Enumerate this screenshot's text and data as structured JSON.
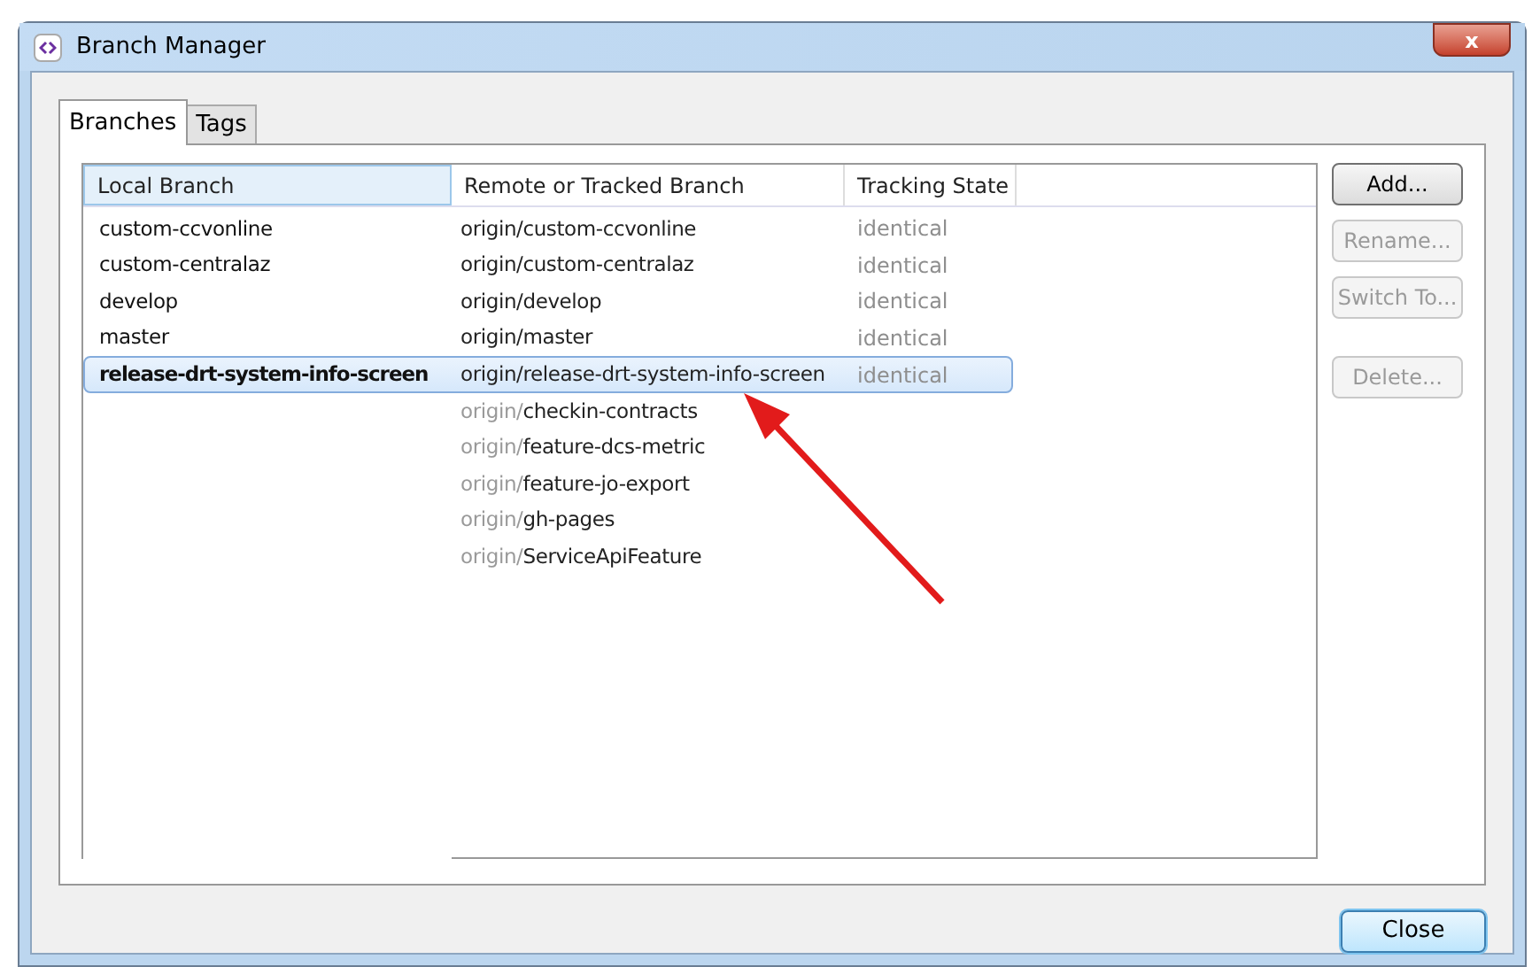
{
  "window": {
    "title": "Branch Manager",
    "close_label": "x"
  },
  "tabs": [
    {
      "label": "Branches",
      "selected": true
    },
    {
      "label": "Tags",
      "selected": false
    }
  ],
  "table": {
    "columns": [
      "Local Branch",
      "Remote or Tracked Branch",
      "Tracking State"
    ],
    "rows": [
      {
        "kind": "tracked",
        "local": "custom-ccvonline",
        "remote_prefix": "origin/",
        "remote_name": "custom-ccvonline",
        "state": "identical",
        "selected": false
      },
      {
        "kind": "tracked",
        "local": "custom-centralaz",
        "remote_prefix": "origin/",
        "remote_name": "custom-centralaz",
        "state": "identical",
        "selected": false
      },
      {
        "kind": "tracked",
        "local": "develop",
        "remote_prefix": "origin/",
        "remote_name": "develop",
        "state": "identical",
        "selected": false
      },
      {
        "kind": "tracked",
        "local": "master",
        "remote_prefix": "origin/",
        "remote_name": "master",
        "state": "identical",
        "selected": false
      },
      {
        "kind": "tracked",
        "local": "release-drt-system-info-screen",
        "remote_prefix": "origin/",
        "remote_name": "release-drt-system-info-screen",
        "state": "identical",
        "selected": true
      },
      {
        "kind": "remote",
        "remote_prefix": "origin/",
        "remote_name": "checkin-contracts",
        "selected": false
      },
      {
        "kind": "remote",
        "remote_prefix": "origin/",
        "remote_name": "feature-dcs-metric",
        "selected": false
      },
      {
        "kind": "remote",
        "remote_prefix": "origin/",
        "remote_name": "feature-jo-export",
        "selected": false
      },
      {
        "kind": "remote",
        "remote_prefix": "origin/",
        "remote_name": "gh-pages",
        "selected": false
      },
      {
        "kind": "remote",
        "remote_prefix": "origin/",
        "remote_name": "ServiceApiFeature",
        "selected": false
      }
    ]
  },
  "side_buttons": [
    {
      "label": "Add...",
      "disabled": false
    },
    {
      "label": "Rename...",
      "disabled": true
    },
    {
      "label": "Switch To...",
      "disabled": true
    },
    {
      "label": "Delete...",
      "disabled": true
    }
  ],
  "footer_button": {
    "label": "Close"
  }
}
